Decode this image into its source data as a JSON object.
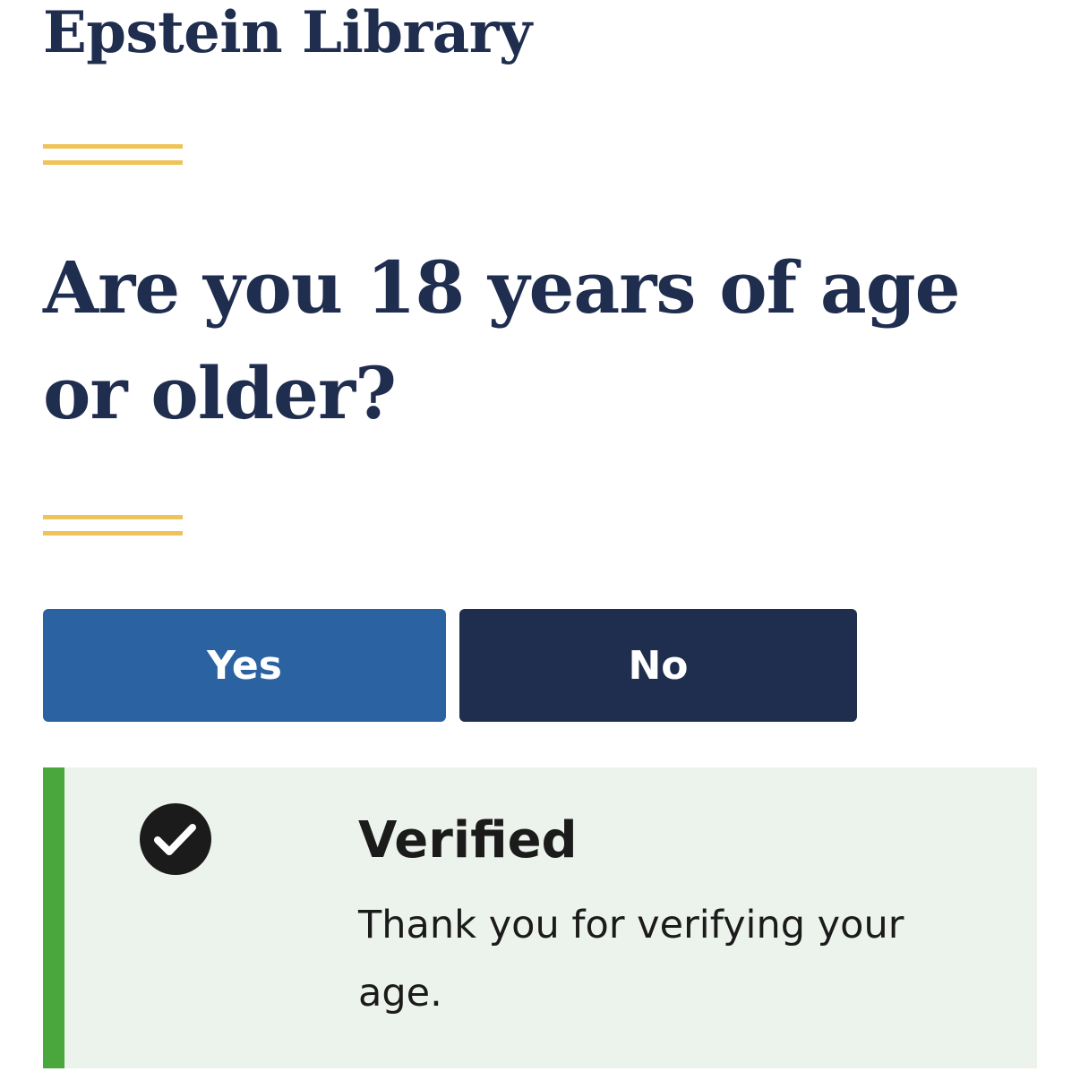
{
  "site": {
    "title": "Epstein Library"
  },
  "age_gate": {
    "question": "Are you 18 years of age or older?",
    "yes_label": "Yes",
    "no_label": "No"
  },
  "alert": {
    "type": "success",
    "icon": "check-circle-icon",
    "heading": "Verified",
    "message": "Thank you for verifying your age."
  },
  "colors": {
    "navy": "#1f2d4f",
    "primary_blue": "#2b63a2",
    "accent_gold": "#eec35a",
    "success_green": "#4aa73d",
    "alert_background": "#ecf2ec"
  }
}
